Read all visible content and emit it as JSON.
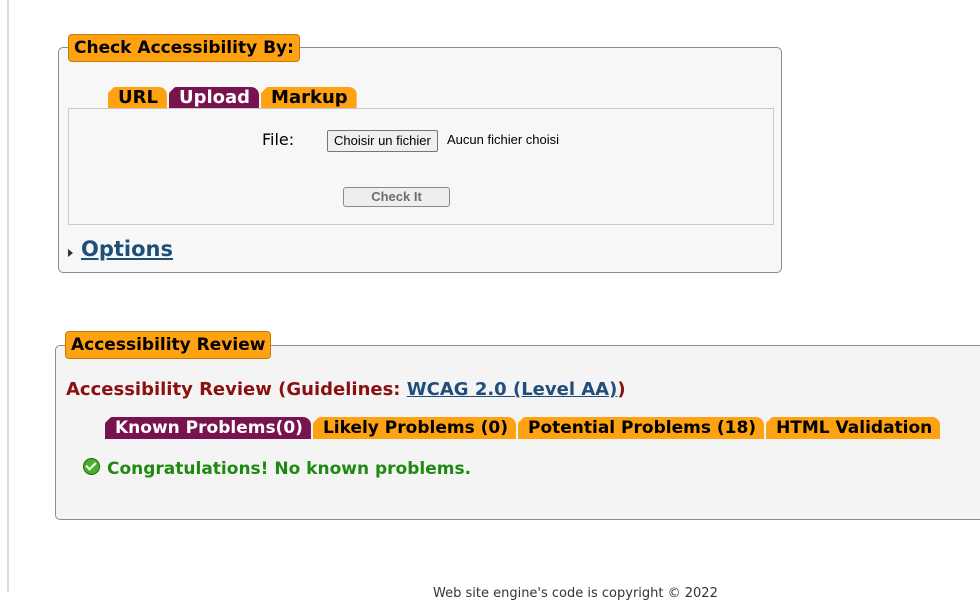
{
  "check_box": {
    "legend": "Check Accessibility By:",
    "tabs": [
      {
        "label": "URL",
        "active": false
      },
      {
        "label": "Upload",
        "active": true
      },
      {
        "label": "Markup",
        "active": false
      }
    ],
    "file_label": "File:",
    "file_button": "Choisir un fichier",
    "file_status": "Aucun fichier choisi",
    "check_button": "Check It",
    "options_link": "Options"
  },
  "review": {
    "legend": "Accessibility Review",
    "heading_prefix": "Accessibility Review (Guidelines: ",
    "guideline_link": "WCAG 2.0 (Level AA)",
    "heading_suffix": ")",
    "tabs": [
      {
        "label": "Known Problems(0)",
        "active": true
      },
      {
        "label": "Likely Problems (0)",
        "active": false
      },
      {
        "label": "Potential Problems (18)",
        "active": false
      },
      {
        "label": "HTML Validation",
        "active": false
      }
    ],
    "success_message": "Congratulations! No known problems."
  },
  "footer": {
    "text": "Web site engine's code is copyright © 2022"
  },
  "colors": {
    "tab_orange": "#ffa212",
    "tab_active": "#78134f",
    "heading_red": "#8b1010",
    "link_blue": "#1f4e79",
    "success_green": "#1e8a12"
  }
}
